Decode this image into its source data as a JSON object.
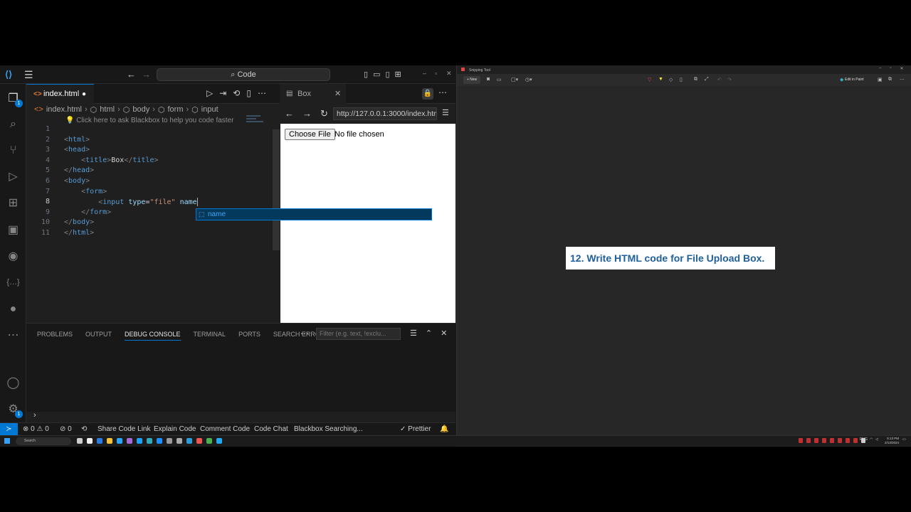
{
  "vscode": {
    "command_center": "Code",
    "activity": {
      "explorer_badge": "1",
      "settings_badge": "1"
    },
    "tab": {
      "filename": "index.html"
    },
    "breadcrumb": [
      "index.html",
      "html",
      "body",
      "form",
      "input"
    ],
    "blackbox_hint": "Click here to ask Blackbox to help you code faster",
    "code_lines": [
      {
        "n": "1"
      },
      {
        "n": "2"
      },
      {
        "n": "3"
      },
      {
        "n": "4"
      },
      {
        "n": "5"
      },
      {
        "n": "6"
      },
      {
        "n": "7"
      },
      {
        "n": "8"
      },
      {
        "n": "9"
      },
      {
        "n": "10"
      },
      {
        "n": "11"
      }
    ],
    "code": {
      "l2": [
        "<",
        "html",
        ">"
      ],
      "l3": [
        "<",
        "head",
        ">"
      ],
      "l4": [
        "    <",
        "title",
        ">",
        "Box",
        "</",
        "title",
        ">"
      ],
      "l5": [
        "</",
        "head",
        ">"
      ],
      "l6": [
        "<",
        "body",
        ">"
      ],
      "l7": [
        "    <",
        "form",
        ">"
      ],
      "l8": [
        "        <",
        "input",
        " ",
        "type",
        "=",
        "\"file\"",
        " ",
        "name"
      ],
      "l9": [
        "    </",
        "form",
        ">"
      ],
      "l10": [
        "</",
        "body",
        ">"
      ],
      "l11": [
        "</",
        "html",
        ">"
      ]
    },
    "suggestion": "name",
    "preview": {
      "tab_title": "Box",
      "url": "http://127.0.0.1:3000/index.html",
      "file_button": "Choose File",
      "file_status": "No file chosen"
    },
    "panel": {
      "tabs": [
        "PROBLEMS",
        "OUTPUT",
        "DEBUG CONSOLE",
        "TERMINAL",
        "PORTS",
        "SEARCH ERROR"
      ],
      "active_tab": "DEBUG CONSOLE",
      "filter_placeholder": "Filter (e.g. text, !exclu..."
    },
    "status": {
      "errors": "0",
      "warnings": "0",
      "ports": "0",
      "items": [
        "Share Code Link",
        "Explain Code",
        "Comment Code",
        "Code Chat",
        "Blackbox Searching..."
      ],
      "prettier": "Prettier"
    }
  },
  "snipping_tool": {
    "title": "Snipping Tool",
    "new_label": "New",
    "edit_in_paint": "Edit in Paint",
    "captured_text": "12. Write HTML code for File Upload Box."
  },
  "taskbar": {
    "search": "Search",
    "lang": "ENG",
    "time": "5:13 PM",
    "date": "2/13/2024"
  }
}
